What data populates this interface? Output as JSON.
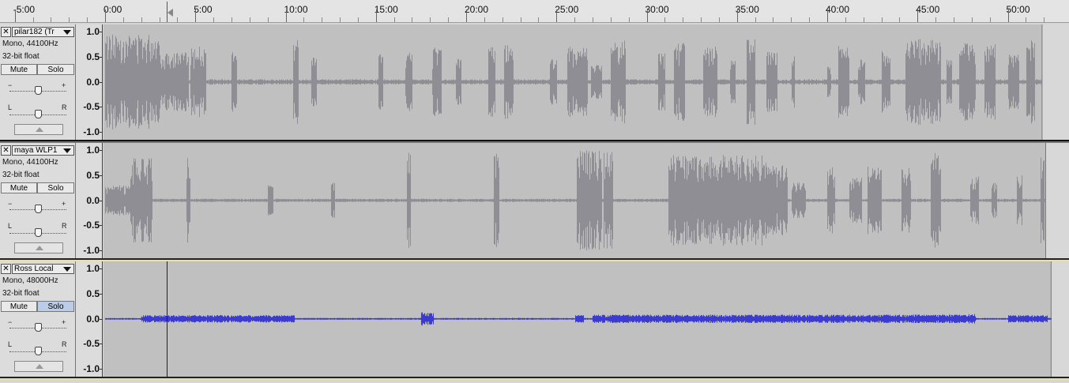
{
  "timeline": {
    "labels": [
      "-5:00",
      "0:00",
      "5:00",
      "10:00",
      "15:00",
      "20:00",
      "25:00",
      "30:00",
      "35:00",
      "40:00",
      "45:00",
      "50:00"
    ],
    "minutes": [
      -5,
      0,
      5,
      10,
      15,
      20,
      25,
      30,
      35,
      40,
      45,
      50
    ],
    "cursor_minutes": 3.4
  },
  "vertical_scale_labels": [
    "1.0",
    "0.5",
    "0.0",
    "-0.5",
    "-1.0"
  ],
  "tracks": [
    {
      "name": "pilar182 (Tr",
      "rate": "Mono, 44100Hz",
      "format": "32-bit float",
      "mute_label": "Mute",
      "solo_label": "Solo",
      "solo_on": false,
      "gain_minus": "−",
      "gain_plus": "+",
      "pan_left": "L",
      "pan_right": "R",
      "gain_level": 0.5,
      "pan_level": 0.5,
      "end_minutes": 51.9,
      "color": "#8e8e94",
      "bursts": [
        [
          0.0,
          3.0,
          0.95
        ],
        [
          3.0,
          4.6,
          0.6
        ],
        [
          4.7,
          5.6,
          0.7
        ],
        [
          7.0,
          7.3,
          0.6
        ],
        [
          10.4,
          10.7,
          0.85
        ],
        [
          11.4,
          11.7,
          0.5
        ],
        [
          15.1,
          15.4,
          0.55
        ],
        [
          16.6,
          17.0,
          0.6
        ],
        [
          18.1,
          18.6,
          0.7
        ],
        [
          19.4,
          19.7,
          0.45
        ],
        [
          21.2,
          21.6,
          0.7
        ],
        [
          22.1,
          22.6,
          0.75
        ],
        [
          24.6,
          25.0,
          0.45
        ],
        [
          25.6,
          26.7,
          0.7
        ],
        [
          26.9,
          27.5,
          0.35
        ],
        [
          28.0,
          28.8,
          0.85
        ],
        [
          30.6,
          31.0,
          0.6
        ],
        [
          31.5,
          32.1,
          0.85
        ],
        [
          33.1,
          33.9,
          0.7
        ],
        [
          34.6,
          34.9,
          0.45
        ],
        [
          35.5,
          36.0,
          0.85
        ],
        [
          36.6,
          37.2,
          0.6
        ],
        [
          38.0,
          38.2,
          0.55
        ],
        [
          40.0,
          40.2,
          0.35
        ],
        [
          40.6,
          41.2,
          0.75
        ],
        [
          41.7,
          42.1,
          0.45
        ],
        [
          43.0,
          43.5,
          0.65
        ],
        [
          44.3,
          46.3,
          0.85
        ],
        [
          46.6,
          46.9,
          0.5
        ],
        [
          47.3,
          48.2,
          0.8
        ],
        [
          48.7,
          49.3,
          0.75
        ],
        [
          50.0,
          50.6,
          0.55
        ],
        [
          51.0,
          51.5,
          0.9
        ]
      ],
      "base_amp": 0.05
    },
    {
      "name": "maya WLP1",
      "rate": "Mono, 44100Hz",
      "format": "32-bit float",
      "mute_label": "Mute",
      "solo_label": "Solo",
      "solo_on": false,
      "gain_minus": "−",
      "gain_plus": "+",
      "pan_left": "L",
      "pan_right": "R",
      "gain_level": 0.5,
      "pan_level": 0.5,
      "end_minutes": 52.1,
      "color": "#8e8e94",
      "bursts": [
        [
          0.0,
          1.4,
          0.3
        ],
        [
          1.4,
          2.6,
          0.85
        ],
        [
          4.5,
          4.7,
          0.9
        ],
        [
          9.0,
          9.3,
          0.3
        ],
        [
          12.5,
          12.7,
          0.35
        ],
        [
          16.7,
          16.9,
          0.95
        ],
        [
          21.5,
          21.8,
          1.0
        ],
        [
          26.1,
          27.5,
          1.0
        ],
        [
          27.6,
          28.1,
          1.0
        ],
        [
          31.2,
          36.6,
          0.9
        ],
        [
          36.6,
          37.8,
          0.7
        ],
        [
          38.0,
          38.8,
          0.35
        ],
        [
          40.0,
          40.4,
          0.7
        ],
        [
          41.2,
          41.9,
          0.45
        ],
        [
          42.2,
          43.0,
          0.7
        ],
        [
          44.1,
          44.6,
          0.65
        ],
        [
          45.7,
          46.3,
          0.95
        ],
        [
          47.9,
          48.4,
          0.5
        ],
        [
          49.1,
          49.4,
          0.35
        ],
        [
          50.5,
          50.8,
          0.5
        ],
        [
          51.8,
          52.0,
          0.95
        ]
      ],
      "base_amp": 0.03
    },
    {
      "name": "Ross Local",
      "rate": "Mono, 48000Hz",
      "format": "32-bit float",
      "mute_label": "Mute",
      "solo_label": "Solo",
      "solo_on": true,
      "gain_minus": "−",
      "gain_plus": "+",
      "pan_left": "L",
      "pan_right": "R",
      "gain_level": 0.5,
      "pan_level": 0.5,
      "end_minutes": 52.4,
      "color": "#3b3bd0",
      "bursts": [
        [
          2.0,
          10.5,
          0.07
        ],
        [
          17.5,
          18.2,
          0.13
        ],
        [
          26.0,
          26.5,
          0.07
        ],
        [
          27.0,
          47.8,
          0.08
        ],
        [
          47.8,
          48.2,
          0.09
        ],
        [
          50.0,
          52.2,
          0.07
        ]
      ],
      "base_amp": 0.015
    }
  ]
}
